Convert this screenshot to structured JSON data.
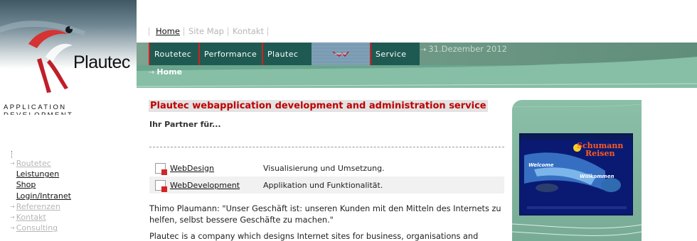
{
  "logo": {
    "name_part1": "Plau",
    "name_part2": "tec",
    "subtitle": "APPLICATION DEVELOPMENT"
  },
  "top_nav": [
    {
      "label": "Home",
      "active": true
    },
    {
      "label": "Site Map",
      "active": false
    },
    {
      "label": "Kontakt",
      "active": false
    }
  ],
  "main_nav": [
    {
      "label": "Routetec"
    },
    {
      "label": "Performance"
    },
    {
      "label": "Plautec"
    },
    {
      "label": ""
    },
    {
      "label": "Service"
    }
  ],
  "date": "31.Dezember 2012",
  "breadcrumb": "Home",
  "left_nav": [
    {
      "label": "Routetec",
      "style": "muted"
    },
    {
      "label": "Leistungen",
      "style": "strong"
    },
    {
      "label": "Shop",
      "style": "strong"
    },
    {
      "label": "Login/Intranet",
      "style": "strong"
    },
    {
      "label": "Referenzen",
      "style": "muted"
    },
    {
      "label": "Kontakt",
      "style": "muted"
    },
    {
      "label": "Consulting",
      "style": "muted"
    }
  ],
  "content": {
    "headline": "Plautec webapplication development and administration service",
    "subtitle": "Ihr Partner für...",
    "services": [
      {
        "link": "WebDesign",
        "desc": "Visualisierung und Umsetzung."
      },
      {
        "link": "WebDevelopment",
        "desc": "Applikation und Funktionalität."
      }
    ],
    "quote": "Thimo Plaumann: \"Unser Geschäft ist: unseren Kunden mit den Mitteln des Internets zu helfen, selbst bessere Geschäfte zu machen.\"",
    "paragraph": "Plautec is a company which designs Internet sites for business, organisations and"
  },
  "reference_shot": {
    "logo_line1": "Schumann",
    "logo_line2": "Reisen",
    "welcome": "Welcome",
    "willkommen": "Willkommen"
  },
  "colors": {
    "brand_red": "#c00000",
    "band_green": "#6aa58e",
    "nav_dark": "#1f5a52"
  }
}
